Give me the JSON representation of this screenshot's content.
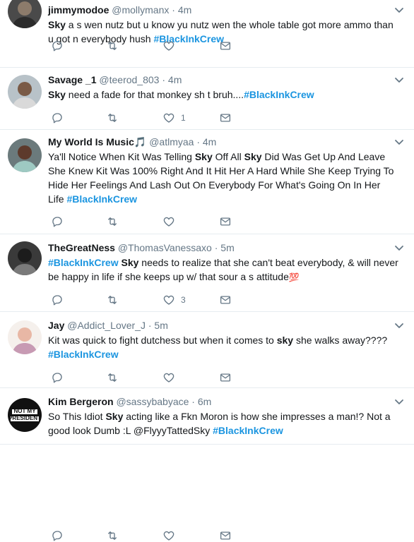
{
  "tweets": [
    {
      "name": "jimmymodoe",
      "handle": "@mollymanx",
      "dot": "·",
      "time": "4m",
      "text": [
        {
          "t": "Sky",
          "s": "b"
        },
        {
          "t": " a  s wen nutz but u know yu nutz wen the whole table got more ammo than u got n everybody hush  "
        },
        {
          "t": "#BlackInkCrew",
          "s": "tag"
        }
      ],
      "likes": ""
    },
    {
      "name": "Savage _1",
      "handle": "@teerod_803",
      "dot": "·",
      "time": "4m",
      "text": [
        {
          "t": "Sky",
          "s": "b"
        },
        {
          "t": " need a fade for that monkey  sh  t bruh...."
        },
        {
          "t": "#BlackInkCrew",
          "s": "tag"
        }
      ],
      "likes": "1"
    },
    {
      "name": "My World Is Music",
      "name_emoji": "🎵",
      "handle": "@atlmyaa",
      "dot": "·",
      "time": "4m",
      "text": [
        {
          "t": "Ya'll Notice When Kit Was Telling "
        },
        {
          "t": "Sky",
          "s": "b"
        },
        {
          "t": " Off All "
        },
        {
          "t": "Sky",
          "s": "b"
        },
        {
          "t": " Did Was Get Up And Leave She Knew Kit Was 100% Right And It Hit Her A   Hard While She Keep Trying To Hide Her Feelings And Lash Out On Everybody For What's Going On In Her Life "
        },
        {
          "t": "#BlackInkCrew",
          "s": "tag"
        }
      ],
      "likes": ""
    },
    {
      "name": "TheGreatNess",
      "handle": "@ThomasVanessaxo",
      "dot": "·",
      "time": "5m",
      "text": [
        {
          "t": "#BlackInkCrew",
          "s": "tag"
        },
        {
          "t": " "
        },
        {
          "t": "Sky",
          "s": "b"
        },
        {
          "t": " needs to realize that she can't beat everybody, & will never be happy in life if she keeps up w/ that sour a  s attitude"
        },
        {
          "t": "💯",
          "s": "hundred"
        }
      ],
      "likes": "3"
    },
    {
      "name": "Jay",
      "handle": "@Addict_Lover_J",
      "dot": "·",
      "time": "5m",
      "text": [
        {
          "t": "Kit was quick to fight dutchess but when it comes to "
        },
        {
          "t": "sky",
          "s": "b"
        },
        {
          "t": " she walks away???? "
        },
        {
          "t": "#BlackInkCrew",
          "s": "tag"
        }
      ],
      "likes": ""
    },
    {
      "name": "Kim Bergeron",
      "handle": "@sassybabyace",
      "dot": "·",
      "time": "6m",
      "avatar_text": "NOT MY PRESIDENT",
      "text": [
        {
          "t": "So This Idiot "
        },
        {
          "t": "Sky",
          "s": "b"
        },
        {
          "t": " acting like a Fkn Moron  is how she impresses a man!? Not a good look Dumb    :L  @FlyyyTattedSky "
        },
        {
          "t": "#BlackInkCrew",
          "s": "tag"
        }
      ],
      "likes": ""
    }
  ],
  "colors": {
    "hashtag": "#1b95e0",
    "meta": "#657786",
    "border": "#e6ecf0",
    "text": "#14171a"
  },
  "icons": [
    "reply-icon",
    "retweet-icon",
    "like-icon",
    "dm-icon",
    "chevron-down-icon"
  ]
}
